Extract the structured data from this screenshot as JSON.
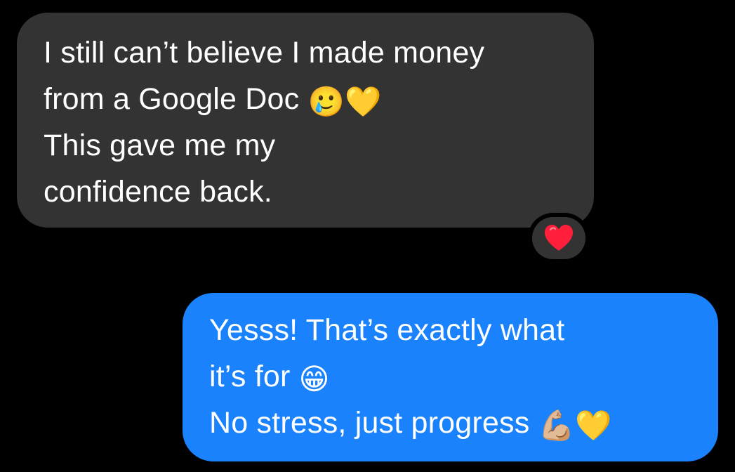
{
  "messages": [
    {
      "direction": "incoming",
      "lines": [
        "I still can’t believe I made money",
        "from a Google Doc",
        "This gave me my",
        "confidence back."
      ],
      "emojis": [
        "🥲",
        "💛"
      ],
      "tapback": {
        "icon": "red-heart-icon",
        "color": "#ff1f3a"
      }
    },
    {
      "direction": "outgoing",
      "lines": [
        "Yesss! That’s exactly what",
        "it’s for",
        "No stress, just progress"
      ],
      "emojis": [
        "😁",
        "💪🏼",
        "💛"
      ]
    }
  ],
  "colors": {
    "background": "#000000",
    "incoming_bubble": "#333333",
    "outgoing_bubble": "#1982fc",
    "text": "#ffffff"
  }
}
